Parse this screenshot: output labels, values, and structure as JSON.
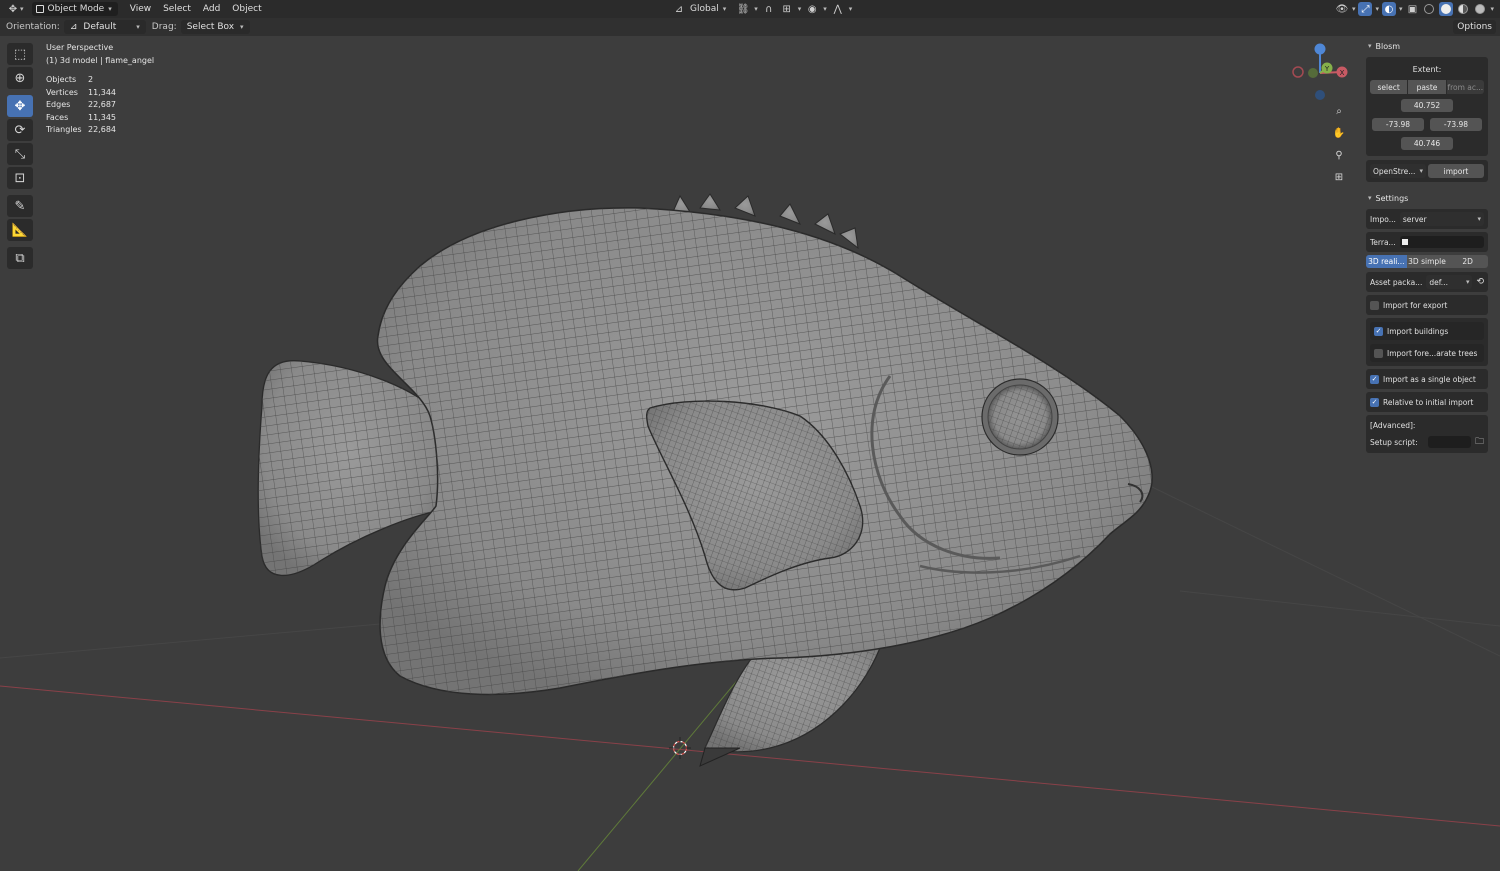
{
  "header": {
    "mode": "Object Mode",
    "menus": [
      "View",
      "Select",
      "Add",
      "Object"
    ],
    "transform_orientation": "Global"
  },
  "tool_settings": {
    "orientation_label": "Orientation:",
    "orientation_value": "Default",
    "drag_label": "Drag:",
    "drag_value": "Select Box",
    "options_label": "Options"
  },
  "viewport_info": {
    "view_name": "User Perspective",
    "object_line": "(1) 3d model | flame_angel",
    "stats": [
      {
        "label": "Objects",
        "value": "2"
      },
      {
        "label": "Vertices",
        "value": "11,344"
      },
      {
        "label": "Edges",
        "value": "22,687"
      },
      {
        "label": "Faces",
        "value": "11,345"
      },
      {
        "label": "Triangles",
        "value": "22,684"
      }
    ]
  },
  "gizmo": {
    "y_label": "Y",
    "x_label": "X"
  },
  "npanel": {
    "blosm_title": "Blosm",
    "extent": {
      "title": "Extent:",
      "buttons": [
        "select",
        "paste",
        "from ac..."
      ],
      "top": "40.752",
      "left": "-73.98",
      "right": "-73.98",
      "bottom": "40.746"
    },
    "provider": "OpenStre...",
    "import_label": "import",
    "settings_title": "Settings",
    "import_label_short": "Impo...",
    "import_source": "server",
    "terrain_label": "Terra...",
    "modes": [
      "3D reali...",
      "3D simple",
      "2D"
    ],
    "asset_label": "Asset packa...",
    "asset_value": "def...",
    "options": [
      {
        "label": "Import for export",
        "checked": false
      },
      {
        "label": "Import buildings",
        "checked": true
      },
      {
        "label": "Import fore...arate trees",
        "checked": false
      },
      {
        "label": "Import as a single object",
        "checked": true
      },
      {
        "label": "Relative to initial import",
        "checked": true
      }
    ],
    "advanced_label": "[Advanced]:",
    "setup_script_label": "Setup script:"
  },
  "colors": {
    "accent": "#4772b3",
    "axis_x": "#c85a64",
    "axis_y": "#86b04a",
    "axis_z": "#4f87d6",
    "mesh_fill": "#8e8e8e",
    "wire": "#3c3c3c"
  }
}
